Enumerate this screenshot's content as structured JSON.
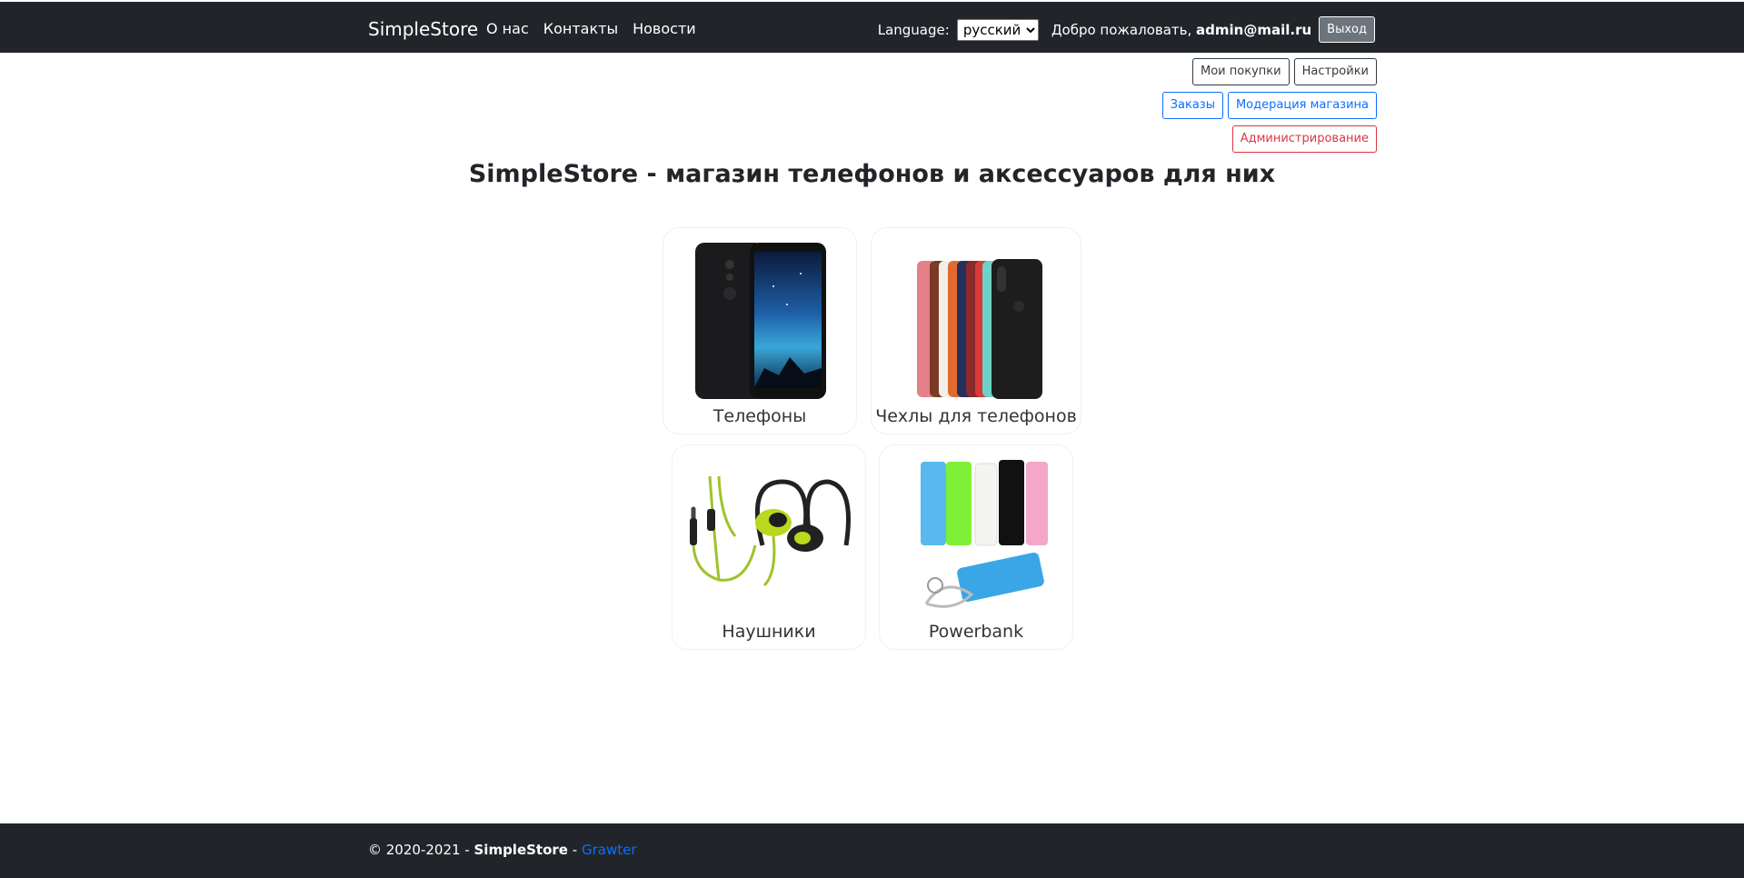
{
  "navbar": {
    "brand": "SimpleStore",
    "links": [
      "О нас",
      "Контакты",
      "Новости"
    ],
    "language_label": "Language:",
    "language_value": "русский",
    "welcome_text": "Добро пожаловать,",
    "user_email": "admin@mail.ru",
    "logout_label": "Выход"
  },
  "actions": {
    "my_purchases": "Мои покупки",
    "settings": "Настройки",
    "orders": "Заказы",
    "store_moderation": "Модерация магазина",
    "administration": "Администрирование"
  },
  "main": {
    "title": "SimpleStore - магазин телефонов и аксессуаров для них"
  },
  "categories": [
    {
      "label": "Телефоны",
      "icon": "phone-image"
    },
    {
      "label": "Чехлы для телефонов",
      "icon": "phone-cases-image"
    },
    {
      "label": "Наушники",
      "icon": "earphones-image"
    },
    {
      "label": "Powerbank",
      "icon": "powerbank-image"
    }
  ],
  "footer": {
    "copyright": "© 2020-2021 -",
    "brand": "SimpleStore",
    "separator": "-",
    "author": "Grawter"
  },
  "colors": {
    "navbar_bg": "#212529",
    "primary": "#0d6efd",
    "danger": "#dc3545"
  }
}
